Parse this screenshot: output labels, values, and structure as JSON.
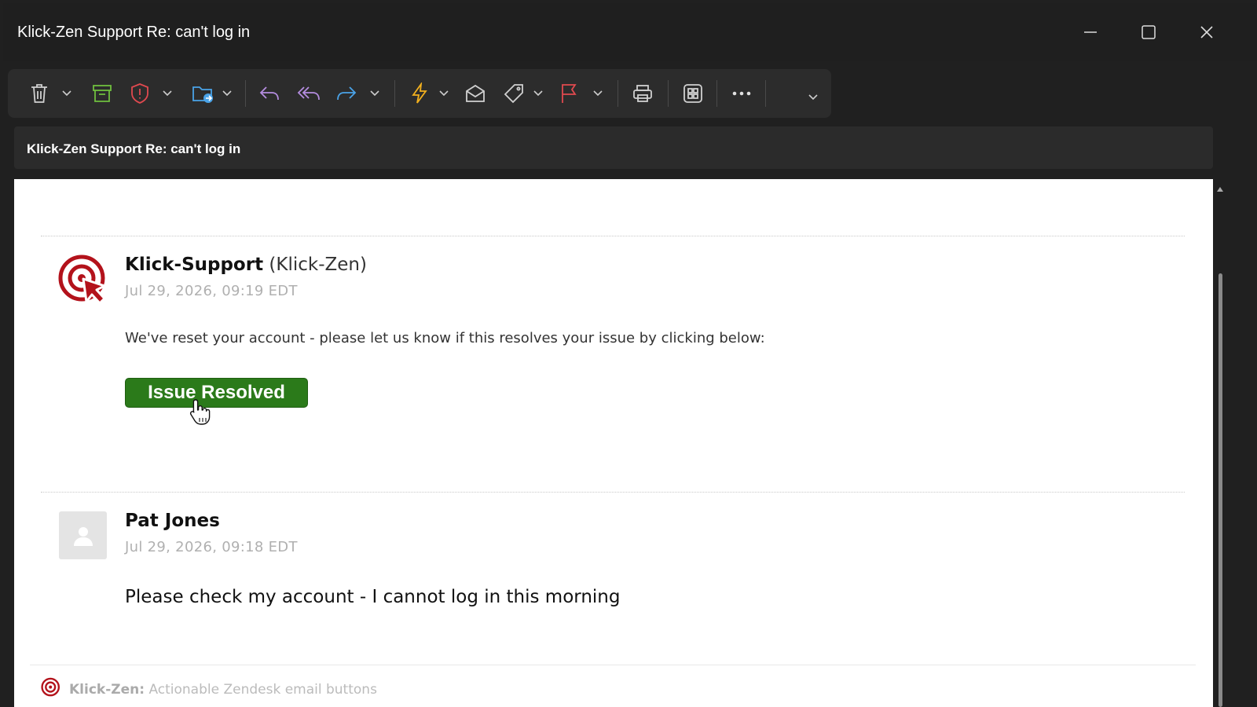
{
  "window": {
    "title": "Klick-Zen Support Re: can't log in"
  },
  "window_controls": [
    "minimize-icon",
    "maximize-icon",
    "close-icon"
  ],
  "toolbar": {
    "buttons": [
      {
        "name": "delete",
        "icon": "trash-icon",
        "color": "#d0d0d0",
        "dropdown": true
      },
      {
        "name": "archive",
        "icon": "archive-icon",
        "color": "#6fbf3f",
        "dropdown": false
      },
      {
        "name": "report",
        "icon": "shield-icon",
        "color": "#e0494f",
        "dropdown": true
      },
      {
        "name": "move",
        "icon": "folder-move-icon",
        "color": "#4aa3e8",
        "dropdown": true
      },
      {
        "name": "reply",
        "icon": "reply-icon",
        "color": "#b58de0",
        "dropdown": false
      },
      {
        "name": "reply-all",
        "icon": "reply-all-icon",
        "color": "#b58de0",
        "dropdown": false
      },
      {
        "name": "forward",
        "icon": "forward-icon",
        "color": "#4aa3e8",
        "dropdown": true
      },
      {
        "name": "quick-steps",
        "icon": "lightning-icon",
        "color": "#f2b01e",
        "dropdown": true
      },
      {
        "name": "read-unread",
        "icon": "envelope-open-icon",
        "color": "#d0d0d0",
        "dropdown": false
      },
      {
        "name": "tag",
        "icon": "tag-icon",
        "color": "#d0d0d0",
        "dropdown": true
      },
      {
        "name": "flag",
        "icon": "flag-icon",
        "color": "#e0494f",
        "dropdown": true
      },
      {
        "name": "print",
        "icon": "printer-icon",
        "color": "#d0d0d0",
        "dropdown": false
      },
      {
        "name": "apps",
        "icon": "apps-grid-icon",
        "color": "#d0d0d0",
        "dropdown": false
      },
      {
        "name": "more",
        "icon": "more-icon",
        "color": "#d0d0d0",
        "dropdown": false
      }
    ]
  },
  "subject": "Klick-Zen Support Re: can't log in",
  "messages": [
    {
      "sender_name": "Klick-Support",
      "sender_org": "(Klick-Zen)",
      "date": "Jul 29, 2026, 09:19 EDT",
      "body": "We've reset your account - please let us know if this resolves your issue by clicking below:",
      "button_label": "Issue Resolved"
    },
    {
      "sender_name": "Pat Jones",
      "date": "Jul 29, 2026, 09:18 EDT",
      "body": "Please check my account - I cannot log in this morning"
    }
  ],
  "footer": {
    "brand": "Klick-Zen:",
    "tagline": "Actionable Zendesk email buttons"
  },
  "colors": {
    "brand_red": "#b3121b",
    "button_green": "#2b7a1a"
  }
}
